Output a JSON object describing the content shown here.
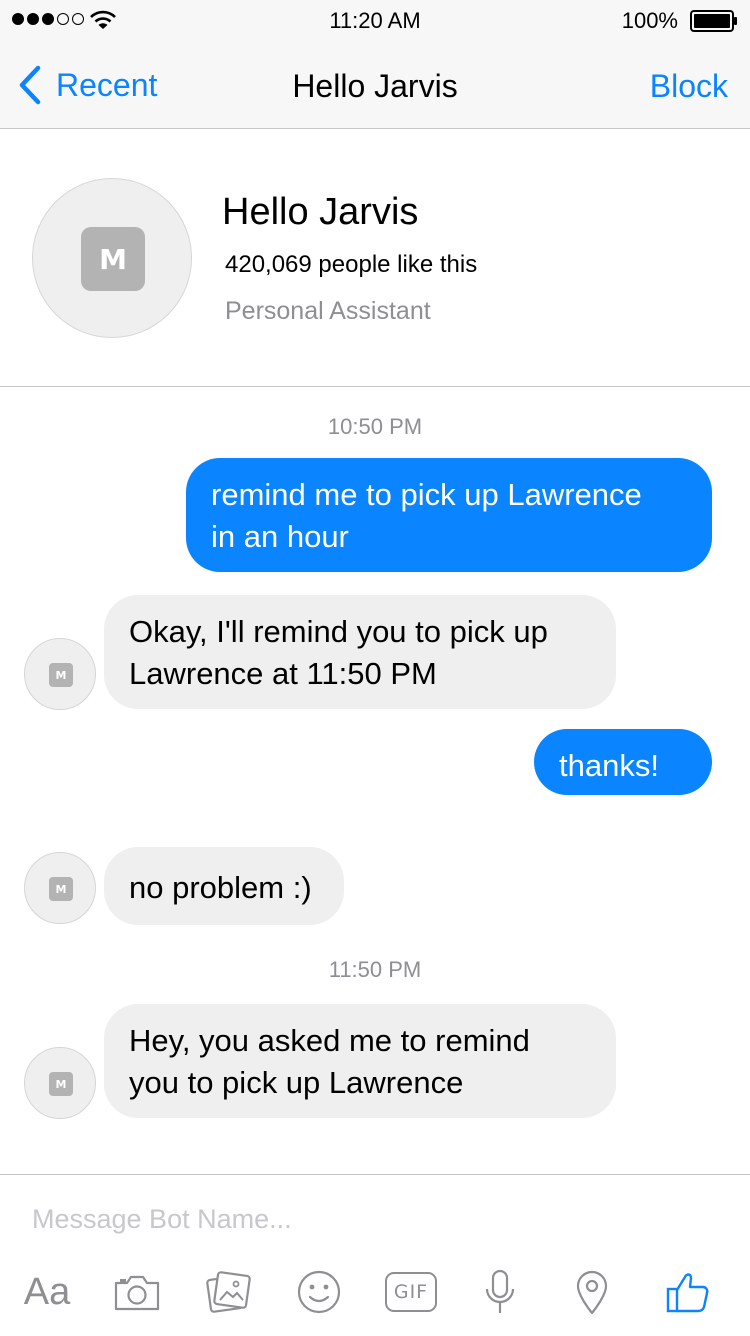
{
  "status_bar": {
    "time": "11:20 AM",
    "battery": "100%"
  },
  "nav": {
    "back_label": "Recent",
    "title": "Hello Jarvis",
    "action_label": "Block"
  },
  "profile": {
    "badge_letter": "M",
    "name": "Hello Jarvis",
    "likes": "420,069 people like this",
    "category": "Personal Assistant"
  },
  "conversation": {
    "timestamps": [
      "10:50 PM",
      "11:50 PM"
    ],
    "messages": [
      {
        "from": "user",
        "lines": [
          "remind me to pick up Lawrence",
          "in an hour"
        ]
      },
      {
        "from": "bot",
        "lines": [
          "Okay, I'll remind you to pick up",
          "Lawrence at 11:50 PM"
        ]
      },
      {
        "from": "user",
        "lines": [
          "thanks!"
        ]
      },
      {
        "from": "bot",
        "lines": [
          "no problem :)"
        ]
      },
      {
        "from": "bot",
        "lines": [
          "Hey, you asked me to remind",
          "you to pick up Lawrence"
        ]
      }
    ],
    "bot_avatar_letter": "M"
  },
  "composer": {
    "placeholder": "Message Bot Name...",
    "text_format_label": "Aa",
    "gif_label": "GIF",
    "tools": [
      "text-format",
      "camera",
      "photo-gallery",
      "emoji",
      "gif",
      "microphone",
      "location",
      "like"
    ]
  },
  "colors": {
    "accent": "#0a84ff",
    "incoming_bubble": "#efefef",
    "muted_text": "#8e8e93"
  }
}
